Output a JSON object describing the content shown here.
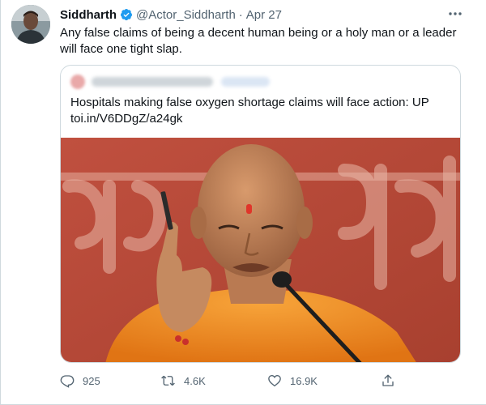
{
  "tweet": {
    "display_name": "Siddharth",
    "handle": "@Actor_Siddharth",
    "separator": "·",
    "date": "Apr 27",
    "text": "Any false claims of being a decent human being or a holy man or a leader will face one tight slap."
  },
  "quoted": {
    "text": "Hospitals making false oxygen shortage claims will face action: UP",
    "link": "toi.in/V6DDgZ/a24gk"
  },
  "actions": {
    "reply_count": "925",
    "retweet_count": "4.6K",
    "like_count": "16.9K"
  },
  "icons": {
    "verified": "verified-badge-icon",
    "more": "more-options-icon",
    "reply": "reply-icon",
    "retweet": "retweet-icon",
    "like": "heart-icon",
    "share": "share-icon"
  },
  "colors": {
    "brand_blue": "#1d9bf0",
    "text_primary": "#0f1419",
    "text_secondary": "#536471",
    "border": "#cfd9de",
    "image_backdrop_red": "#b84a3c",
    "saffron_robe": "#f08a1d"
  }
}
